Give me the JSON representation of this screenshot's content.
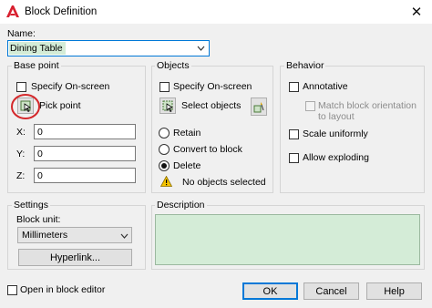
{
  "window": {
    "title": "Block Definition"
  },
  "name": {
    "label": "Name:",
    "value": "Dining Table"
  },
  "base_point": {
    "legend": "Base point",
    "specify_onscreen": "Specify On-screen",
    "pick_point": "Pick point",
    "x_label": "X:",
    "x_value": "0",
    "y_label": "Y:",
    "y_value": "0",
    "z_label": "Z:",
    "z_value": "0"
  },
  "objects": {
    "legend": "Objects",
    "specify_onscreen": "Specify On-screen",
    "select_objects": "Select objects",
    "retain": "Retain",
    "convert": "Convert to block",
    "delete": "Delete",
    "selected_radio": "Delete",
    "warning": "No objects selected"
  },
  "behavior": {
    "legend": "Behavior",
    "annotative": "Annotative",
    "match_orientation_line1": "Match block orientation",
    "match_orientation_line2": "to layout",
    "scale_uniformly": "Scale uniformly",
    "allow_exploding": "Allow exploding"
  },
  "settings": {
    "legend": "Settings",
    "block_unit_label": "Block unit:",
    "block_unit_value": "Millimeters",
    "hyperlink_button": "Hyperlink..."
  },
  "description": {
    "legend": "Description",
    "value": ""
  },
  "footer": {
    "open_in_editor": "Open in block editor",
    "ok": "OK",
    "cancel": "Cancel",
    "help": "Help"
  },
  "colors": {
    "accent": "#0078d7",
    "highlight_field": "#d4ecd7",
    "logo_red": "#d8202f",
    "annotation_circle": "#d4282b"
  }
}
